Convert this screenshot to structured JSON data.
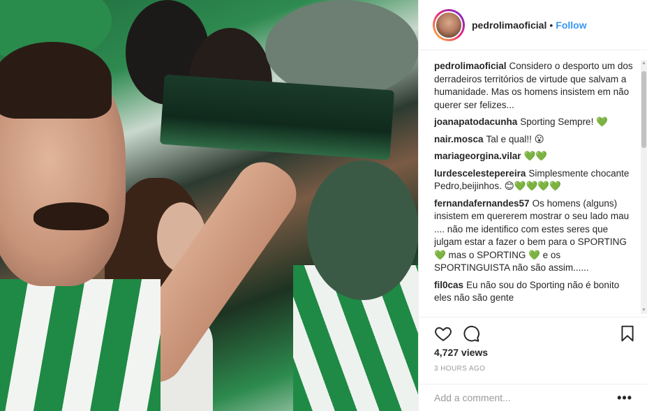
{
  "post": {
    "username": "pedrolimaoficial",
    "follow_label": "Follow",
    "separator": "•",
    "views": "4,727 views",
    "timestamp": "3 HOURS AGO",
    "add_comment_placeholder": "Add a comment...",
    "more_label": "•••"
  },
  "caption": {
    "username": "pedrolimaoficial",
    "text": "Considero o desporto um dos derradeiros territórios de virtude que salvam a humanidade. Mas os homens insistem em não querer ser felizes..."
  },
  "comments": [
    {
      "username": "joanapatodacunha",
      "text": "Sporting Sempre! 💚"
    },
    {
      "username": "nair.mosca",
      "text": "Tal e qual!! 😮"
    },
    {
      "username": "mariageorgina.vilar",
      "text": "💚💚"
    },
    {
      "username": "lurdescelestepereira",
      "text": "Simplesmente chocante Pedro,beijinhos. 😊💚💚💚💚"
    },
    {
      "username": "fernandafernandes57",
      "text": "Os homens (alguns) insistem em quererem mostrar o seu lado mau .... não me identifico com estes seres que julgam estar a fazer o bem para o SPORTING 💚 mas o SPORTING 💚 e os SPORTINGUISTA não são assim......"
    },
    {
      "username": "fil0cas",
      "text": "Eu não sou do Sporting não é bonito eles não são gente"
    }
  ],
  "icons": {
    "like": "heart-icon",
    "comment": "comment-icon",
    "save": "bookmark-icon"
  },
  "colors": {
    "accent": "#3897f0",
    "text": "#262626",
    "muted": "#999999"
  }
}
